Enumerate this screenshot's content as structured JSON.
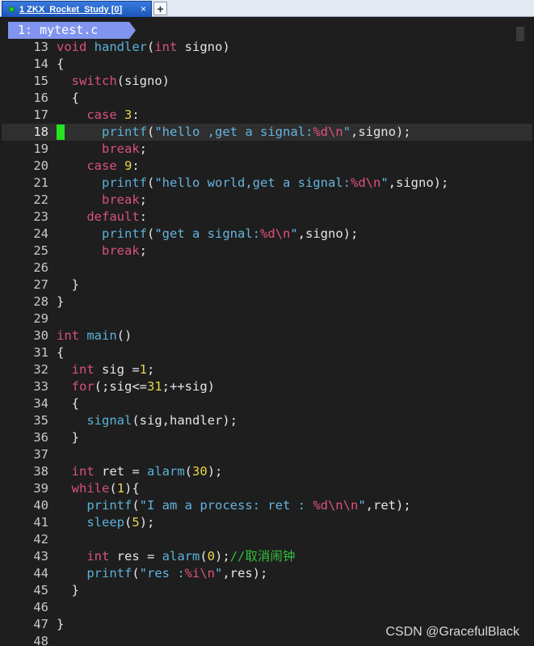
{
  "tab": {
    "title": "1 ZKX_Rocket_Study [0]",
    "close_glyph": "×",
    "newtab_glyph": "+"
  },
  "buffer": {
    "label": "1: mytest.c"
  },
  "watermark": "CSDN @GracefulBlack",
  "cursor_line": 18,
  "colors": {
    "keyword": "#d8527f",
    "function": "#5ab2d9",
    "string": "#66b4e0",
    "escape": "#e0527f",
    "number": "#e9d64a",
    "comment": "#35c03a",
    "sign_marker": "#27e322",
    "buffer_tab": "#8195f0",
    "tab_active": "#1c55b9"
  },
  "lines": [
    {
      "n": "13",
      "parts": [
        [
          "ty",
          "void"
        ],
        [
          "t",
          " "
        ],
        [
          "fn",
          "handler"
        ],
        [
          "t",
          "("
        ],
        [
          "ty",
          "int"
        ],
        [
          "t",
          " signo)"
        ]
      ]
    },
    {
      "n": "14",
      "parts": [
        [
          "t",
          "{"
        ]
      ]
    },
    {
      "n": "15",
      "parts": [
        [
          "t",
          "  "
        ],
        [
          "kw",
          "switch"
        ],
        [
          "t",
          "(signo)"
        ]
      ]
    },
    {
      "n": "16",
      "parts": [
        [
          "t",
          "  {"
        ]
      ]
    },
    {
      "n": "17",
      "parts": [
        [
          "t",
          "    "
        ],
        [
          "kw",
          "case"
        ],
        [
          "t",
          " "
        ],
        [
          "num",
          "3"
        ],
        [
          "t",
          ":"
        ]
      ]
    },
    {
      "n": "18",
      "parts": [
        [
          "t",
          "      "
        ],
        [
          "fn",
          "printf"
        ],
        [
          "t",
          "("
        ],
        [
          "str",
          "\"hello ,get a signal:"
        ],
        [
          "esc",
          "%d\\n"
        ],
        [
          "str",
          "\""
        ],
        [
          "t",
          ",signo);"
        ]
      ]
    },
    {
      "n": "19",
      "parts": [
        [
          "t",
          "      "
        ],
        [
          "kw",
          "break"
        ],
        [
          "t",
          ";"
        ]
      ]
    },
    {
      "n": "20",
      "parts": [
        [
          "t",
          "    "
        ],
        [
          "kw",
          "case"
        ],
        [
          "t",
          " "
        ],
        [
          "num",
          "9"
        ],
        [
          "t",
          ":"
        ]
      ]
    },
    {
      "n": "21",
      "parts": [
        [
          "t",
          "      "
        ],
        [
          "fn",
          "printf"
        ],
        [
          "t",
          "("
        ],
        [
          "str",
          "\"hello world,get a signal:"
        ],
        [
          "esc",
          "%d\\n"
        ],
        [
          "str",
          "\""
        ],
        [
          "t",
          ",signo);"
        ]
      ]
    },
    {
      "n": "22",
      "parts": [
        [
          "t",
          "      "
        ],
        [
          "kw",
          "break"
        ],
        [
          "t",
          ";"
        ]
      ]
    },
    {
      "n": "23",
      "parts": [
        [
          "t",
          "    "
        ],
        [
          "kw",
          "default"
        ],
        [
          "t",
          ":"
        ]
      ]
    },
    {
      "n": "24",
      "parts": [
        [
          "t",
          "      "
        ],
        [
          "fn",
          "printf"
        ],
        [
          "t",
          "("
        ],
        [
          "str",
          "\"get a signal:"
        ],
        [
          "esc",
          "%d\\n"
        ],
        [
          "str",
          "\""
        ],
        [
          "t",
          ",signo);"
        ]
      ]
    },
    {
      "n": "25",
      "parts": [
        [
          "t",
          "      "
        ],
        [
          "kw",
          "break"
        ],
        [
          "t",
          ";"
        ]
      ]
    },
    {
      "n": "26",
      "parts": []
    },
    {
      "n": "27",
      "parts": [
        [
          "t",
          "  }"
        ]
      ]
    },
    {
      "n": "28",
      "parts": [
        [
          "t",
          "}"
        ]
      ]
    },
    {
      "n": "29",
      "parts": []
    },
    {
      "n": "30",
      "parts": [
        [
          "ty",
          "int"
        ],
        [
          "t",
          " "
        ],
        [
          "fn",
          "main"
        ],
        [
          "t",
          "()"
        ]
      ]
    },
    {
      "n": "31",
      "parts": [
        [
          "t",
          "{"
        ]
      ]
    },
    {
      "n": "32",
      "parts": [
        [
          "t",
          "  "
        ],
        [
          "ty",
          "int"
        ],
        [
          "t",
          " sig ="
        ],
        [
          "num",
          "1"
        ],
        [
          "t",
          ";"
        ]
      ]
    },
    {
      "n": "33",
      "parts": [
        [
          "t",
          "  "
        ],
        [
          "kw",
          "for"
        ],
        [
          "t",
          "(;sig<="
        ],
        [
          "num",
          "31"
        ],
        [
          "t",
          ";++sig)"
        ]
      ]
    },
    {
      "n": "34",
      "parts": [
        [
          "t",
          "  {"
        ]
      ]
    },
    {
      "n": "35",
      "parts": [
        [
          "t",
          "    "
        ],
        [
          "fn",
          "signal"
        ],
        [
          "t",
          "(sig,handler);"
        ]
      ]
    },
    {
      "n": "36",
      "parts": [
        [
          "t",
          "  }"
        ]
      ]
    },
    {
      "n": "37",
      "parts": []
    },
    {
      "n": "38",
      "parts": [
        [
          "t",
          "  "
        ],
        [
          "ty",
          "int"
        ],
        [
          "t",
          " ret = "
        ],
        [
          "fn",
          "alarm"
        ],
        [
          "t",
          "("
        ],
        [
          "num",
          "30"
        ],
        [
          "t",
          ");"
        ]
      ]
    },
    {
      "n": "39",
      "parts": [
        [
          "t",
          "  "
        ],
        [
          "kw",
          "while"
        ],
        [
          "t",
          "("
        ],
        [
          "num",
          "1"
        ],
        [
          "t",
          "){"
        ]
      ]
    },
    {
      "n": "40",
      "parts": [
        [
          "t",
          "    "
        ],
        [
          "fn",
          "printf"
        ],
        [
          "t",
          "("
        ],
        [
          "str",
          "\"I am a process: ret : "
        ],
        [
          "esc",
          "%d\\n\\n"
        ],
        [
          "str",
          "\""
        ],
        [
          "t",
          ",ret);"
        ]
      ]
    },
    {
      "n": "41",
      "parts": [
        [
          "t",
          "    "
        ],
        [
          "fn",
          "sleep"
        ],
        [
          "t",
          "("
        ],
        [
          "num",
          "5"
        ],
        [
          "t",
          ");"
        ]
      ]
    },
    {
      "n": "42",
      "parts": []
    },
    {
      "n": "43",
      "parts": [
        [
          "t",
          "    "
        ],
        [
          "ty",
          "int"
        ],
        [
          "t",
          " res = "
        ],
        [
          "fn",
          "alarm"
        ],
        [
          "t",
          "("
        ],
        [
          "num",
          "0"
        ],
        [
          "t",
          ");"
        ],
        [
          "cm",
          "//取消闹钟"
        ]
      ]
    },
    {
      "n": "44",
      "parts": [
        [
          "t",
          "    "
        ],
        [
          "fn",
          "printf"
        ],
        [
          "t",
          "("
        ],
        [
          "str",
          "\"res :"
        ],
        [
          "esc",
          "%i\\n"
        ],
        [
          "str",
          "\""
        ],
        [
          "t",
          ",res);"
        ]
      ]
    },
    {
      "n": "45",
      "parts": [
        [
          "t",
          "  }"
        ]
      ]
    },
    {
      "n": "46",
      "parts": []
    },
    {
      "n": "47",
      "parts": [
        [
          "t",
          "}"
        ]
      ]
    },
    {
      "n": "48",
      "parts": []
    }
  ]
}
